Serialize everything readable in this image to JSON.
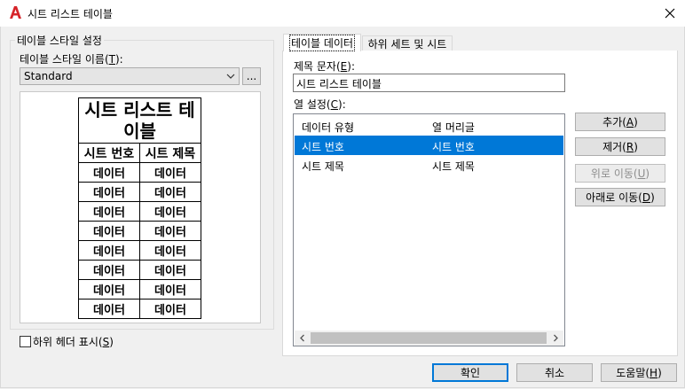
{
  "window": {
    "title": "시트 리스트 테이블",
    "icon": "autocad-app-icon"
  },
  "table_style": {
    "group_label": "테이블 스타일 설정",
    "name_label": "테이블 스타일 이름(T):",
    "selected_style": "Standard",
    "browse_button": "...",
    "preview": {
      "title": "시트 리스트 테이블",
      "headers": [
        "시트 번호",
        "시트 제목"
      ],
      "rows": [
        [
          "데이터",
          "데이터"
        ],
        [
          "데이터",
          "데이터"
        ],
        [
          "데이터",
          "데이터"
        ],
        [
          "데이터",
          "데이터"
        ],
        [
          "데이터",
          "데이터"
        ],
        [
          "데이터",
          "데이터"
        ],
        [
          "데이터",
          "데이터"
        ],
        [
          "데이터",
          "데이터"
        ]
      ]
    },
    "sub_header_checkbox_label": "하위 헤더 표시(S)",
    "sub_header_checked": false
  },
  "tabs": [
    {
      "label": "테이블 데이터",
      "active": true
    },
    {
      "label": "하위 세트 및 시트",
      "active": false
    }
  ],
  "table_data": {
    "title_text_label": "제목 문자(E):",
    "title_text_value": "시트 리스트 테이블",
    "column_settings_label": "열 설정(C):",
    "columns_header": [
      "데이터 유형",
      "열 머리글"
    ],
    "columns": [
      {
        "type": "시트 번호",
        "heading": "시트 번호",
        "selected": true
      },
      {
        "type": "시트 제목",
        "heading": "시트 제목",
        "selected": false
      }
    ],
    "buttons": {
      "add": "추가(A)",
      "remove": "제거(R)",
      "move_up": "위로 이동(U)",
      "move_down": "아래로 이동(D)"
    }
  },
  "footer": {
    "ok": "확인",
    "cancel": "취소",
    "help": "도움말(H)"
  },
  "colors": {
    "selection": "#0078d7",
    "brand_red": "#d6242a"
  }
}
